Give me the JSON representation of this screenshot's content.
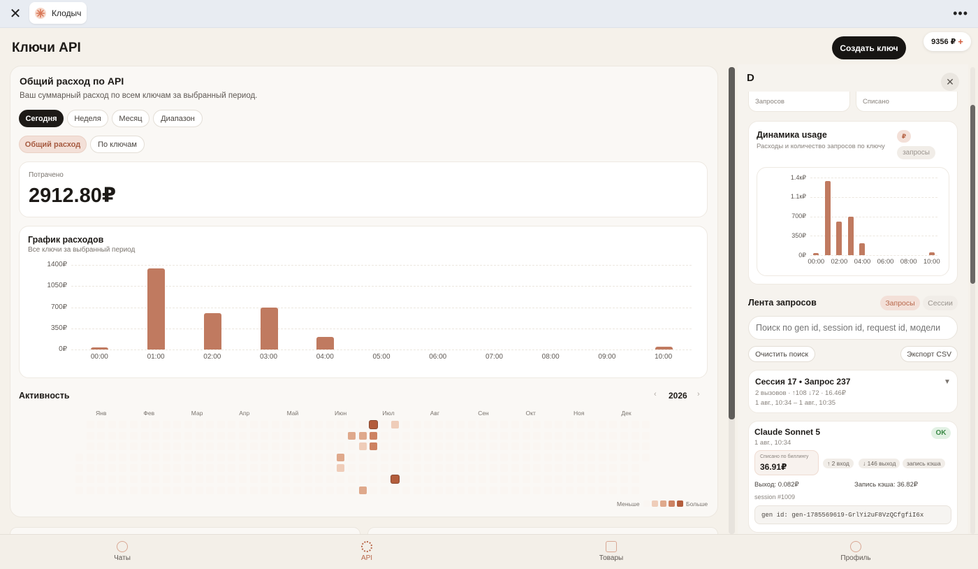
{
  "window": {
    "tab_title": "Клодыч"
  },
  "header": {
    "title": "Ключи API",
    "create_label": "Создать ключ",
    "balance": "9356 ₽",
    "balance_plus": "+"
  },
  "spend": {
    "title": "Общий расход по API",
    "subtitle": "Ваш суммарный расход по всем ключам за выбранный период.",
    "periods": [
      "Сегодня",
      "Неделя",
      "Месяц",
      "Диапазон"
    ],
    "modes": [
      "Общий расход",
      "По ключам"
    ],
    "spent_label": "Потрачено",
    "spent_value": "2912.80₽"
  },
  "chart_main": {
    "title": "График расходов",
    "subtitle": "Все ключи за выбранный период",
    "yticks": [
      "1400₽",
      "1050₽",
      "700₽",
      "350₽",
      "0₽"
    ]
  },
  "chart_data": [
    {
      "type": "bar",
      "title": "График расходов",
      "categories": [
        "00:00",
        "01:00",
        "02:00",
        "03:00",
        "04:00",
        "05:00",
        "06:00",
        "07:00",
        "08:00",
        "09:00",
        "10:00"
      ],
      "values": [
        30,
        1340,
        600,
        700,
        210,
        0,
        0,
        0,
        0,
        0,
        50
      ],
      "ylim": [
        0,
        1400
      ]
    },
    {
      "type": "bar",
      "title": "Динамика usage",
      "categories": [
        "00:00",
        "01:00",
        "02:00",
        "03:00",
        "04:00",
        "05:00",
        "06:00",
        "07:00",
        "08:00",
        "09:00",
        "10:00"
      ],
      "xtick_labels": [
        "00:00",
        "02:00",
        "04:00",
        "06:00",
        "08:00",
        "10:00"
      ],
      "values": [
        30,
        1340,
        600,
        700,
        210,
        0,
        0,
        0,
        0,
        0,
        50
      ],
      "ylim": [
        0,
        1400
      ]
    }
  ],
  "activity": {
    "title": "Активность",
    "year": "2026",
    "months": [
      "Янв",
      "Фев",
      "Мар",
      "Апр",
      "Май",
      "Июн",
      "Июл",
      "Авг",
      "Сен",
      "Окт",
      "Ноя",
      "Дек"
    ],
    "legend_less": "Меньше",
    "legend_more": "Больше",
    "active_cells": [
      {
        "week": 27,
        "day": 0,
        "level": 4
      },
      {
        "week": 29,
        "day": 0,
        "level": 1
      },
      {
        "week": 25,
        "day": 1,
        "level": 2
      },
      {
        "week": 26,
        "day": 1,
        "level": 2
      },
      {
        "week": 27,
        "day": 1,
        "level": 3
      },
      {
        "week": 26,
        "day": 2,
        "level": 1
      },
      {
        "week": 27,
        "day": 2,
        "level": 3
      },
      {
        "week": 24,
        "day": 3,
        "level": 2
      },
      {
        "week": 24,
        "day": 4,
        "level": 1
      },
      {
        "week": 29,
        "day": 5,
        "level": 4
      },
      {
        "week": 26,
        "day": 6,
        "level": 2
      }
    ]
  },
  "panel": {
    "title": "D",
    "stat_labels": [
      "Запросов",
      "Списано"
    ],
    "usage": {
      "title": "Динамика usage",
      "subtitle": "Расходы и количество запросов по ключу",
      "toggle_rub": "₽",
      "toggle_req": "запросы",
      "yticks": [
        "1.4к₽",
        "1.1к₽",
        "700₽",
        "350₽",
        "0₽"
      ]
    },
    "feed": {
      "title": "Лента запросов",
      "tabs": [
        "Запросы",
        "Сессии"
      ],
      "search_placeholder": "Поиск по gen id, session id, request id, модели",
      "clear_label": "Очистить поиск",
      "export_label": "Экспорт CSV"
    },
    "session": {
      "title": "Сессия 17 • Запрос 237",
      "meta": "2 вызовов · ↑108 ↓72 · 16.46₽",
      "dates": "1 авг., 10:34 – 1 авг., 10:35"
    },
    "request": {
      "model": "Claude Sonnet 5",
      "status": "OK",
      "time": "1 авг., 10:34",
      "billing_label": "Списано по биллингу",
      "billing_value": "36.91₽",
      "tags": [
        "↑ 2 вход",
        "↓ 146 выход",
        "запись кэша"
      ],
      "output": "Выход: 0.082₽",
      "cache_write": "Запись кэша: 36.82₽",
      "session": "session #1009",
      "gen_id": "gen id: gen-1785569619-GrlYi2uF8VzQCfgfiI6x"
    }
  },
  "nav": [
    "Чаты",
    "API",
    "Товары",
    "Профиль"
  ]
}
